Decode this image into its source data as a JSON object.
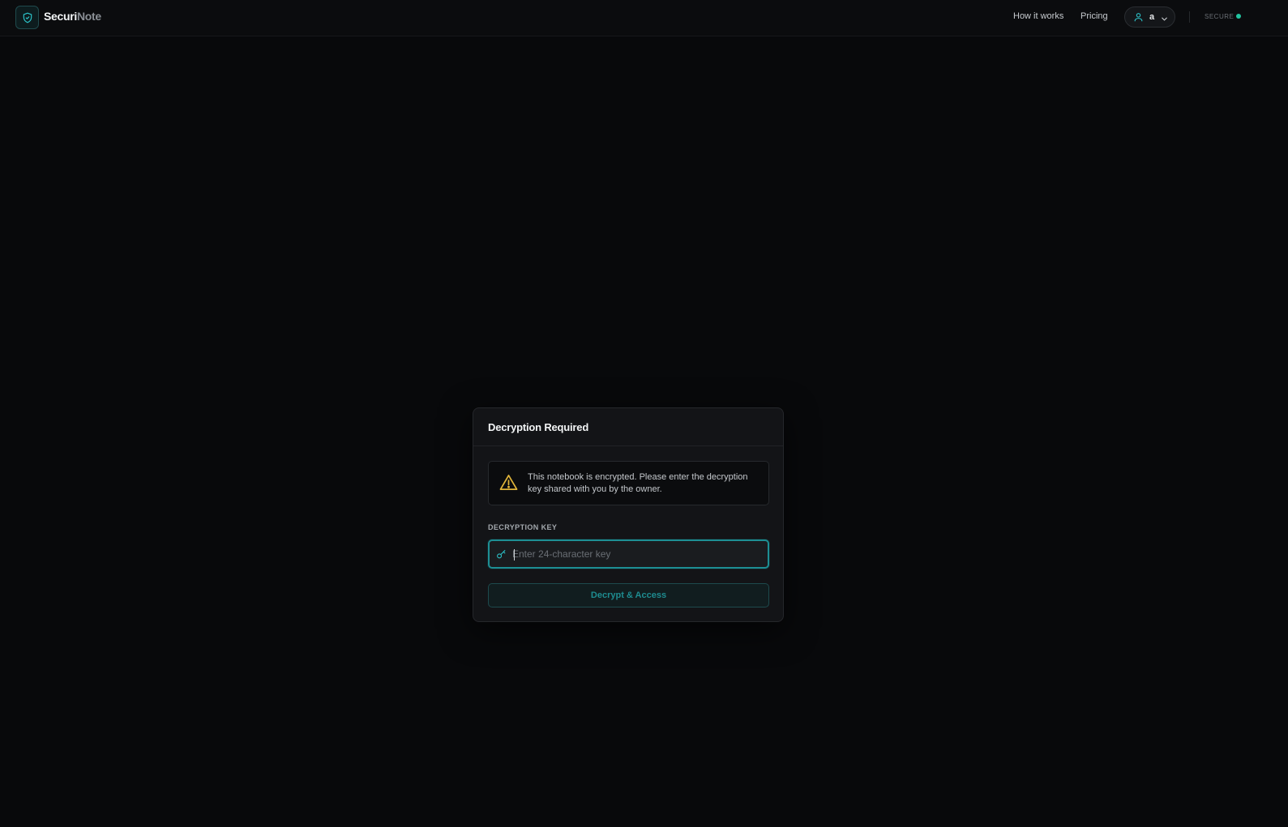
{
  "brand": {
    "name_part1": "Securi",
    "name_part2": "Note"
  },
  "nav": {
    "how_it_works": "How it works",
    "pricing": "Pricing"
  },
  "user": {
    "initial": "a"
  },
  "status": {
    "label": "SECURE",
    "color": "#22c4a0"
  },
  "dialog": {
    "title": "Decryption Required",
    "alert_message": "This notebook is encrypted. Please enter the decryption key shared with you by the owner.",
    "field_label": "DECRYPTION KEY",
    "key_placeholder": "Enter 24-character key",
    "key_value": "",
    "submit_label": "Decrypt & Access"
  },
  "colors": {
    "accent": "#1d8f94",
    "warning": "#e0b43a",
    "background": "#08090b"
  },
  "icons": {
    "logo": "shield-check-icon",
    "user": "user-icon",
    "dropdown": "chevron-down-icon",
    "alert": "warning-triangle-icon",
    "key": "key-icon"
  }
}
